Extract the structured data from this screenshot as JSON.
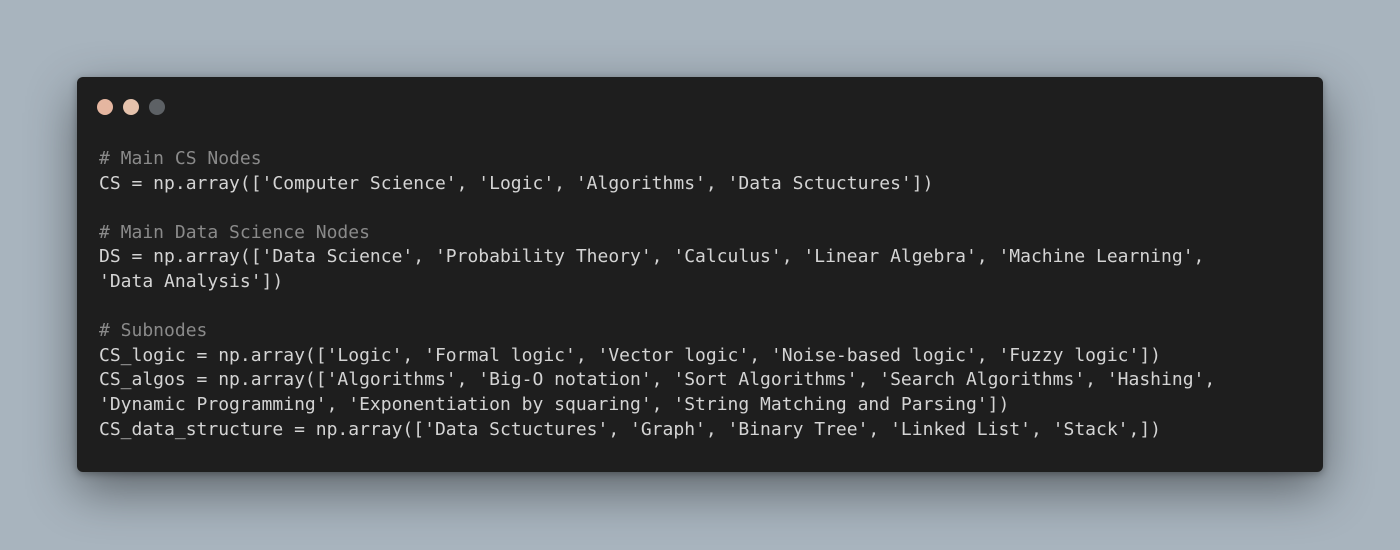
{
  "window": {
    "controls": [
      {
        "name": "close",
        "color": "#e5b6a0"
      },
      {
        "name": "minimize",
        "color": "#e5c2ac"
      },
      {
        "name": "maximize",
        "color": "#5d6165"
      }
    ]
  },
  "code": {
    "lines": [
      {
        "kind": "comment",
        "text": "# Main CS Nodes"
      },
      {
        "kind": "code",
        "text": "CS = np.array(['Computer Science', 'Logic', 'Algorithms', 'Data Sctuctures'])"
      },
      {
        "kind": "blank",
        "text": ""
      },
      {
        "kind": "comment",
        "text": "# Main Data Science Nodes"
      },
      {
        "kind": "code",
        "text": "DS = np.array(['Data Science', 'Probability Theory', 'Calculus', 'Linear Algebra', 'Machine Learning',"
      },
      {
        "kind": "code",
        "text": "'Data Analysis'])"
      },
      {
        "kind": "blank",
        "text": ""
      },
      {
        "kind": "comment",
        "text": "# Subnodes"
      },
      {
        "kind": "code",
        "text": "CS_logic = np.array(['Logic', 'Formal logic', 'Vector logic', 'Noise-based logic', 'Fuzzy logic'])"
      },
      {
        "kind": "code",
        "text": "CS_algos = np.array(['Algorithms', 'Big-O notation', 'Sort Algorithms', 'Search Algorithms', 'Hashing',"
      },
      {
        "kind": "code",
        "text": "'Dynamic Programming', 'Exponentiation by squaring', 'String Matching and Parsing'])"
      },
      {
        "kind": "code",
        "text": "CS_data_structure = np.array(['Data Sctuctures', 'Graph', 'Binary Tree', 'Linked List', 'Stack',])"
      }
    ]
  }
}
